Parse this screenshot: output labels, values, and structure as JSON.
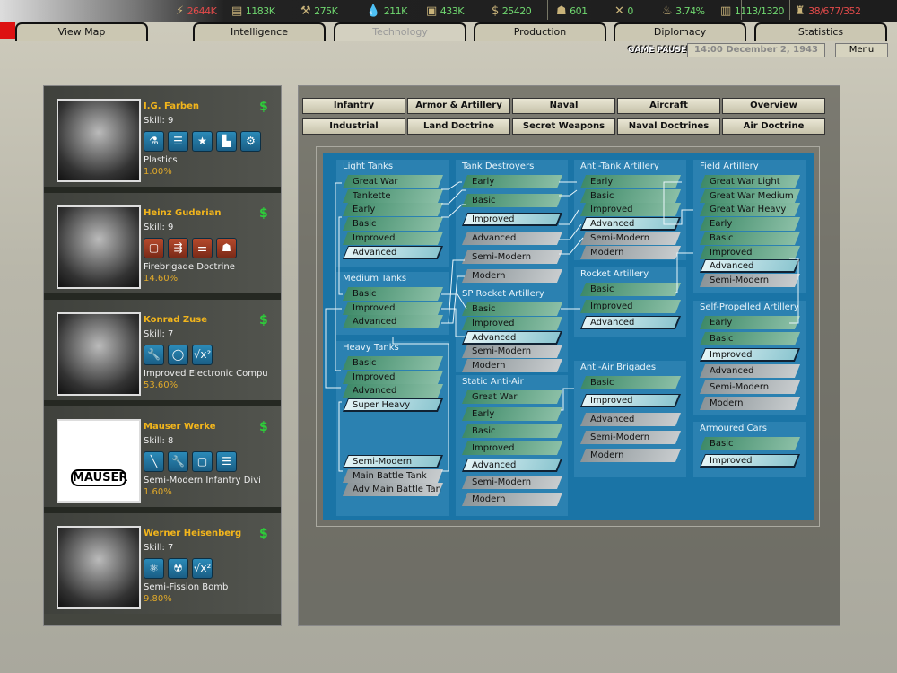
{
  "stats": [
    {
      "icon": "energy-icon",
      "glyph": "⚡",
      "value": "2644K",
      "color": "red"
    },
    {
      "icon": "metal-icon",
      "glyph": "▤",
      "value": "1183K"
    },
    {
      "icon": "rare-materials-icon",
      "glyph": "⚒",
      "value": "275K"
    },
    {
      "icon": "oil-icon",
      "glyph": "💧",
      "value": "211K"
    },
    {
      "icon": "supplies-icon",
      "glyph": "▣",
      "value": "433K"
    },
    {
      "icon": "money-icon",
      "glyph": "$",
      "value": "25420"
    },
    {
      "icon": "manpower-icon",
      "glyph": "☗",
      "value": "601"
    },
    {
      "icon": "diplomacy-icon",
      "glyph": "✕",
      "value": "0"
    },
    {
      "icon": "dissent-icon",
      "glyph": "♨",
      "value": "3.74%"
    },
    {
      "icon": "transport-icon",
      "glyph": "▥",
      "value": "1113/1320"
    },
    {
      "icon": "convoy-icon",
      "glyph": "♜",
      "value": "38/677/352",
      "color": "red"
    }
  ],
  "tabs": [
    "View Map",
    "Intelligence",
    "Technology",
    "Production",
    "Diplomacy",
    "Statistics"
  ],
  "active_tab": "Technology",
  "status": {
    "paused": "GAME PAUSED",
    "date": "14:00 December 2, 1943",
    "menu": "Menu"
  },
  "categories": [
    "Infantry",
    "Armor & Artillery",
    "Naval",
    "Aircraft",
    "Overview",
    "Industrial",
    "Land Doctrine",
    "Secret Weapons",
    "Naval Doctrines",
    "Air Doctrine"
  ],
  "researchers": [
    {
      "name": "I.G. Farben",
      "skill": "Skill: 9",
      "project": "Plastics",
      "progress": "1.00%",
      "icons": [
        [
          "flask-icon",
          "⚗"
        ],
        [
          "database-icon",
          "☰"
        ],
        [
          "star-icon",
          "★"
        ],
        [
          "factory-icon",
          "▙"
        ],
        [
          "gears-icon",
          "⚙"
        ]
      ]
    },
    {
      "name": "Heinz Guderian",
      "skill": "Skill: 9",
      "project": "Firebrigade Doctrine",
      "progress": "14.60%",
      "red": true,
      "icons": [
        [
          "book-icon",
          "▢"
        ],
        [
          "tactics-icon",
          "⇶"
        ],
        [
          "hierarchy-icon",
          "⚌"
        ],
        [
          "infantry-icon",
          "☗"
        ]
      ]
    },
    {
      "name": "Konrad Zuse",
      "skill": "Skill: 7",
      "project": "Improved Electronic Compu",
      "progress": "53.60%",
      "icons": [
        [
          "wrench-icon",
          "🔧"
        ],
        [
          "lightbulb-icon",
          "◯"
        ],
        [
          "math-icon",
          "√x²"
        ]
      ]
    },
    {
      "name": "Mauser Werke",
      "skill": "Skill: 8",
      "project": "Semi-Modern Infantry Divi",
      "progress": "1.60%",
      "logo": "MAUSER",
      "icons": [
        [
          "rifle-icon",
          "╲"
        ],
        [
          "wrench-icon",
          "🔧"
        ],
        [
          "book-icon",
          "▢"
        ],
        [
          "database-icon",
          "☰"
        ]
      ]
    },
    {
      "name": "Werner Heisenberg",
      "skill": "Skill: 7",
      "project": "Semi-Fission Bomb",
      "progress": "9.80%",
      "icons": [
        [
          "atom-icon",
          "⚛"
        ],
        [
          "radiation-icon",
          "☢"
        ],
        [
          "math-icon",
          "√x²"
        ]
      ]
    }
  ],
  "tech_groups": [
    {
      "name": "Light Tanks",
      "items": [
        [
          "Great War",
          "r"
        ],
        [
          "Tankette",
          "r"
        ],
        [
          "Early",
          "r"
        ],
        [
          "Basic",
          "r"
        ],
        [
          "Improved",
          "r"
        ],
        [
          "Advanced",
          "a"
        ]
      ]
    },
    {
      "name": "Medium Tanks",
      "items": [
        [
          "Basic",
          "r"
        ],
        [
          "Improved",
          "r"
        ],
        [
          "Advanced",
          "r"
        ]
      ]
    },
    {
      "name": "Heavy Tanks",
      "items": [
        [
          "Basic",
          "r"
        ],
        [
          "Improved",
          "r"
        ],
        [
          "Advanced",
          "r"
        ],
        [
          "Super Heavy",
          "a"
        ],
        [
          "",
          ""
        ],
        [
          "",
          ""
        ],
        [
          "",
          ""
        ],
        [
          "Semi-Modern",
          "a"
        ],
        [
          "Main Battle Tank",
          "u"
        ],
        [
          "Adv Main Battle Tan",
          "u"
        ]
      ]
    },
    {
      "name": "Tank Destroyers",
      "items": [
        [
          "Early",
          "r"
        ],
        [
          "Basic",
          "r"
        ],
        [
          "Improved",
          "a"
        ],
        [
          "Advanced",
          "u"
        ],
        [
          "Semi-Modern",
          "u"
        ],
        [
          "Modern",
          "u"
        ]
      ]
    },
    {
      "name": "SP Rocket Artillery",
      "items": [
        [
          "Basic",
          "r"
        ],
        [
          "Improved",
          "r"
        ],
        [
          "Advanced",
          "a"
        ],
        [
          "Semi-Modern",
          "u"
        ],
        [
          "Modern",
          "u"
        ]
      ]
    },
    {
      "name": "Static Anti-Air",
      "items": [
        [
          "Great War",
          "r"
        ],
        [
          "Early",
          "r"
        ],
        [
          "Basic",
          "r"
        ],
        [
          "Improved",
          "r"
        ],
        [
          "Advanced",
          "a"
        ],
        [
          "Semi-Modern",
          "u"
        ],
        [
          "Modern",
          "u"
        ]
      ]
    },
    {
      "name": "Anti-Tank Artillery",
      "items": [
        [
          "Early",
          "r"
        ],
        [
          "Basic",
          "r"
        ],
        [
          "Improved",
          "r"
        ],
        [
          "Advanced",
          "a"
        ],
        [
          "Semi-Modern",
          "u"
        ],
        [
          "Modern",
          "u"
        ]
      ]
    },
    {
      "name": "Rocket Artillery",
      "items": [
        [
          "Basic",
          "r"
        ],
        [
          "Improved",
          "r"
        ],
        [
          "Advanced",
          "a"
        ]
      ]
    },
    {
      "name": "Anti-Air Brigades",
      "items": [
        [
          "Basic",
          "r"
        ],
        [
          "Improved",
          "a"
        ],
        [
          "Advanced",
          "u"
        ],
        [
          "Semi-Modern",
          "u"
        ],
        [
          "Modern",
          "u"
        ]
      ]
    },
    {
      "name": "Field Artillery",
      "items": [
        [
          "Great War Light",
          "r"
        ],
        [
          "Great War Medium",
          "r"
        ],
        [
          "Great War Heavy",
          "r"
        ],
        [
          "Early",
          "r"
        ],
        [
          "Basic",
          "r"
        ],
        [
          "Improved",
          "r"
        ],
        [
          "Advanced",
          "a"
        ],
        [
          "Semi-Modern",
          "u"
        ]
      ]
    },
    {
      "name": "Self-Propelled Artillery",
      "items": [
        [
          "Early",
          "r"
        ],
        [
          "Basic",
          "r"
        ],
        [
          "Improved",
          "a"
        ],
        [
          "Advanced",
          "u"
        ],
        [
          "Semi-Modern",
          "u"
        ],
        [
          "Modern",
          "u"
        ]
      ]
    },
    {
      "name": "Armoured Cars",
      "items": [
        [
          "Basic",
          "r"
        ],
        [
          "Improved",
          "a"
        ]
      ]
    }
  ],
  "colors": {
    "researched": "#3e8a68",
    "available": "#c9e8ec",
    "unavailable": "#a0a8ab",
    "tree_bg": "#1a74a6",
    "name": "#f2b51c"
  }
}
